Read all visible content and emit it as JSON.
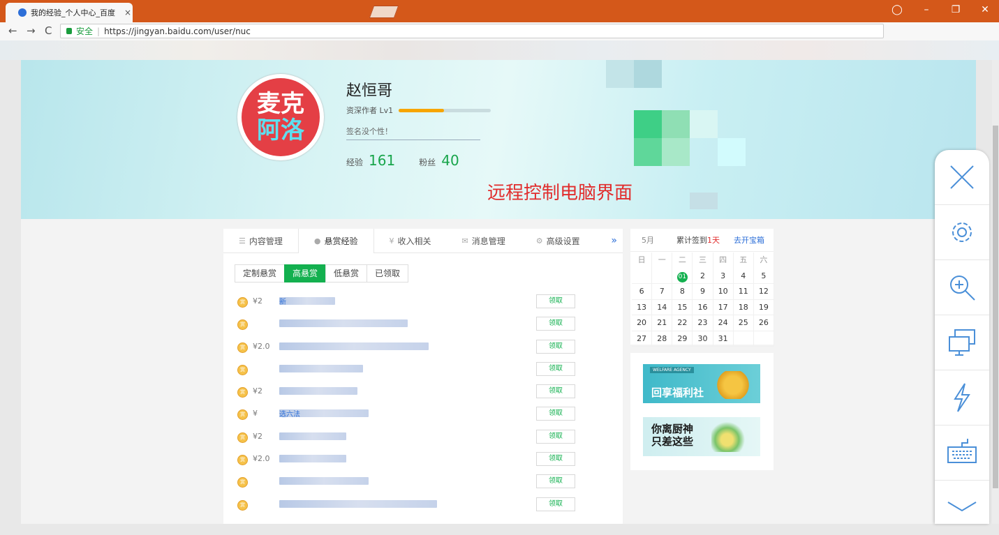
{
  "browser": {
    "tab_title": "我的经验_个人中心_百度",
    "tab_close": "×",
    "secure_label": "安全",
    "url": "https://jingyan.baidu.com/user/nuc",
    "nav_back": "←",
    "nav_forward": "→",
    "nav_reload": "C",
    "window": {
      "account": "◯",
      "minimize": "–",
      "restore": "❐",
      "close": "✕"
    }
  },
  "profile": {
    "avatar_line1": "麦克",
    "avatar_line2": "阿洛",
    "username": "赵恒哥",
    "level_label": "资深作者 Lv1",
    "level_progress": 0.49,
    "signature": "签名没个性！",
    "exp_label": "经验",
    "exp_value": "161",
    "fans_label": "粉丝",
    "fans_value": "40"
  },
  "overlay_note": "远程控制电脑界面",
  "tabs": [
    {
      "label": "内容管理",
      "icon": "list-icon"
    },
    {
      "label": "悬赏经验",
      "icon": "coin-icon"
    },
    {
      "label": "收入相关",
      "icon": "yen-icon"
    },
    {
      "label": "消息管理",
      "icon": "mail-icon"
    },
    {
      "label": "高级设置",
      "icon": "gear-icon"
    }
  ],
  "tabs_more": "»",
  "subtabs": [
    "定制悬赏",
    "高悬赏",
    "低悬赏",
    "已领取"
  ],
  "reward_list": {
    "claim_label": "领取",
    "rows": [
      {
        "reward": "¥2",
        "text": "新"
      },
      {
        "reward": "",
        "text": ""
      },
      {
        "reward": "¥2.0",
        "text": ""
      },
      {
        "reward": "",
        "text": ""
      },
      {
        "reward": "¥2",
        "text": ""
      },
      {
        "reward": "¥",
        "text": "选六法"
      },
      {
        "reward": "¥2",
        "text": ""
      },
      {
        "reward": "¥2.0",
        "text": ""
      },
      {
        "reward": "",
        "text": ""
      },
      {
        "reward": "",
        "text": ""
      }
    ]
  },
  "sign_in": {
    "month": "5月",
    "count_label": "累计签到",
    "count_days": "1天",
    "link": "去开宝箱",
    "weekdays": [
      "日",
      "一",
      "二",
      "三",
      "四",
      "五",
      "六"
    ],
    "weeks": [
      [
        "",
        "",
        "01",
        "2",
        "3",
        "4",
        "5"
      ],
      [
        "6",
        "7",
        "8",
        "9",
        "10",
        "11",
        "12"
      ],
      [
        "13",
        "14",
        "15",
        "16",
        "17",
        "18",
        "19"
      ],
      [
        "20",
        "21",
        "22",
        "23",
        "24",
        "25",
        "26"
      ],
      [
        "27",
        "28",
        "29",
        "30",
        "31",
        "",
        ""
      ]
    ],
    "today": "01"
  },
  "ads": [
    {
      "text": "回享福利社",
      "small": "WELFARE AGENCY",
      "color": "#ffffff"
    },
    {
      "text": "你离厨神\n只差这些",
      "small": "",
      "color": "#1a1a1a"
    }
  ],
  "remote_toolbar": [
    "close-icon",
    "gear-icon",
    "zoom-in-icon",
    "monitor-icon",
    "lightning-icon",
    "keyboard-icon",
    "chevron-down-icon"
  ],
  "colors": {
    "browser_chrome": "#d4581a",
    "accent_green": "#13b04f",
    "note_red": "#e12c2c",
    "link_blue": "#2d6fd8"
  }
}
